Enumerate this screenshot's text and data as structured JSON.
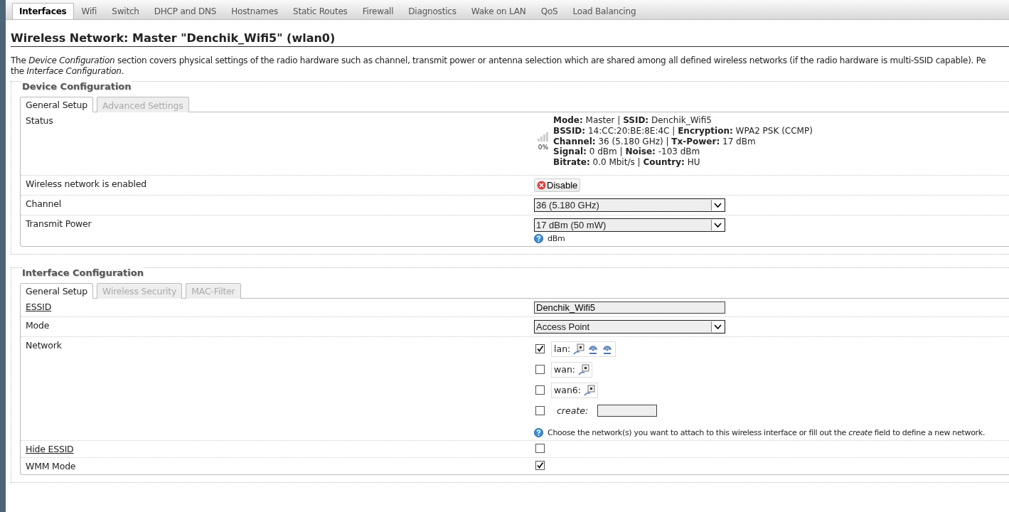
{
  "tabs": [
    {
      "label": "Interfaces",
      "selected": true
    },
    {
      "label": "Wifi",
      "selected": false
    },
    {
      "label": "Switch",
      "selected": false
    },
    {
      "label": "DHCP and DNS",
      "selected": false
    },
    {
      "label": "Hostnames",
      "selected": false
    },
    {
      "label": "Static Routes",
      "selected": false
    },
    {
      "label": "Firewall",
      "selected": false
    },
    {
      "label": "Diagnostics",
      "selected": false
    },
    {
      "label": "Wake on LAN",
      "selected": false
    },
    {
      "label": "QoS",
      "selected": false
    },
    {
      "label": "Load Balancing",
      "selected": false
    }
  ],
  "heading": "Wireless Network: Master \"Denchik_Wifi5\" (wlan0)",
  "description": [
    "The *Device Configuration* section covers physical settings of the radio hardware such as channel, transmit power or antenna selection which are shared among all defined wireless networks (if the radio hardware is multi-SSID capable). Pe",
    "the *Interface Configuration*."
  ],
  "sections": [
    {
      "title": "Device Configuration",
      "tabs": [
        {
          "label": "General Setup",
          "selected": true
        },
        {
          "label": "Advanced Settings",
          "selected": false
        }
      ],
      "rows": [
        {
          "kind": "status",
          "label": "Status",
          "signal": "0%",
          "lines": [
            "**Mode:** Master | **SSID:** Denchik_Wifi5",
            "**BSSID:** 14:CC:20:BE:8E:4C | **Encryption:** WPA2 PSK (CCMP)",
            "**Channel:** 36 (5.180 GHz) | **Tx-Power:** 17 dBm",
            "**Signal:** 0 dBm | **Noise:** -103 dBm",
            "**Bitrate:** 0.0 Mbit/s | **Country:** HU"
          ]
        },
        {
          "kind": "button",
          "label": "Wireless network is enabled",
          "button": "Disable"
        },
        {
          "kind": "select",
          "label": "Channel",
          "value": "36 (5.180 GHz)"
        },
        {
          "kind": "select",
          "label": "Transmit Power",
          "value": "17 dBm (50 mW)",
          "help": "dBm"
        }
      ]
    },
    {
      "title": "Interface Configuration",
      "tabs": [
        {
          "label": "General Setup",
          "selected": true
        },
        {
          "label": "Wireless Security",
          "selected": false
        },
        {
          "label": "MAC-Filter",
          "selected": false
        }
      ],
      "rows": [
        {
          "kind": "text",
          "label": "ESSID",
          "underlined": true,
          "value": "Denchik_Wifi5"
        },
        {
          "kind": "select",
          "label": "Mode",
          "value": "Access Point"
        },
        {
          "kind": "networks",
          "label": "Network",
          "items": [
            {
              "kind": "bridge",
              "label": "lan:",
              "checked": true
            },
            {
              "kind": "network",
              "label": "wan:",
              "checked": false
            },
            {
              "kind": "network",
              "label": "wan6:",
              "checked": false
            },
            {
              "kind": "create",
              "label": "create:",
              "checked": false
            }
          ],
          "help": "Choose the network(s) you want to attach to this wireless interface or fill out the *create* field to define a new network."
        },
        {
          "kind": "checkbox",
          "label": "Hide ESSID",
          "underlined": true,
          "checked": false
        },
        {
          "kind": "checkbox",
          "label": "WMM Mode",
          "checked": true
        }
      ]
    }
  ]
}
